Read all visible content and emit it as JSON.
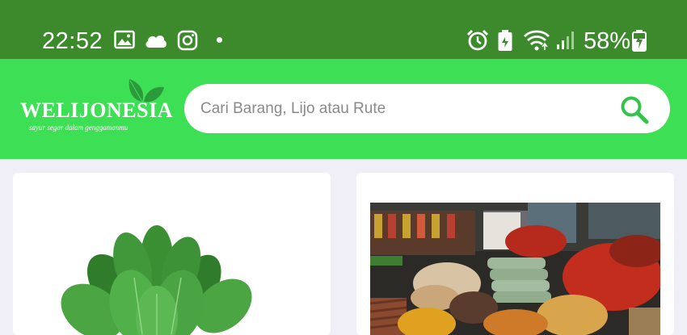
{
  "status_bar": {
    "time": "22:52",
    "battery_percent": "58%",
    "left_icons": [
      "image-icon",
      "cloud-icon",
      "instagram-icon",
      "notification-dot"
    ],
    "right_icons": [
      "alarm-icon",
      "battery-saver-icon",
      "wifi-icon",
      "signal-icon",
      "battery-charging-icon"
    ]
  },
  "header": {
    "logo_text": "WELIJONESIA",
    "logo_tagline": "sayur segar dalam genggamanmu",
    "search": {
      "placeholder": "Cari Barang, Lijo atau Rute",
      "icon": "search-icon"
    }
  },
  "products": [
    {
      "image": "spinach-image"
    },
    {
      "image": "spice-market-image"
    }
  ],
  "colors": {
    "status_bar": "#3c8a2c",
    "header": "#3ddf54",
    "accent": "#3ddf54",
    "background": "#f0eff7"
  }
}
